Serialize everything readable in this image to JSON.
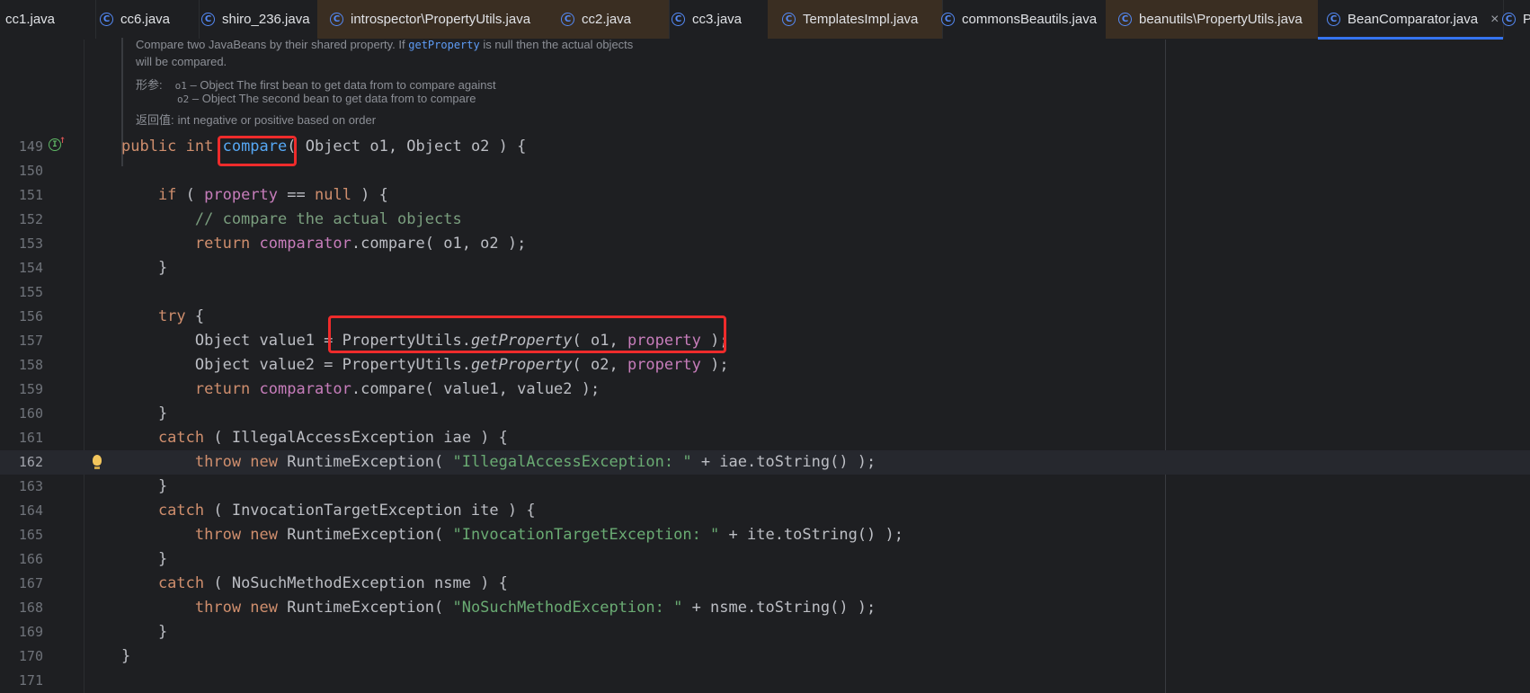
{
  "tabs": [
    {
      "label": "cc1.java",
      "modified": false,
      "active": false
    },
    {
      "label": "cc6.java",
      "modified": false,
      "active": false
    },
    {
      "label": "shiro_236.java",
      "modified": false,
      "active": false
    },
    {
      "label": "introspector\\PropertyUtils.java",
      "modified": true,
      "active": false
    },
    {
      "label": "cc2.java",
      "modified": true,
      "active": false
    },
    {
      "label": "cc3.java",
      "modified": false,
      "active": false
    },
    {
      "label": "TemplatesImpl.java",
      "modified": true,
      "active": false
    },
    {
      "label": "commonsBeautils.java",
      "modified": false,
      "active": false
    },
    {
      "label": "beanutils\\PropertyUtils.java",
      "modified": true,
      "active": false
    },
    {
      "label": "BeanComparator.java",
      "modified": false,
      "active": true
    },
    {
      "label": "P",
      "modified": false,
      "active": false
    }
  ],
  "doc": {
    "line1_pre": "Compare two JavaBeans by their shared property. If ",
    "line1_code": "getProperty",
    "line1_post": " is null then the actual objects",
    "line2": "will be compared.",
    "params_label": "形参:",
    "param1_name": "o1",
    "param1_desc": " – Object The first bean to get data from to compare against",
    "param2_name": "o2",
    "param2_desc": " – Object The second bean to get data from to compare",
    "returns_label": "返回值:",
    "returns_desc": "int negative or positive based on order"
  },
  "lines": [
    {
      "num": "149",
      "code": [
        {
          "t": "public int ",
          "c": "kw"
        },
        {
          "t": "compare",
          "c": "fn"
        },
        {
          "t": "( Object o1, Object o2 ) {",
          "c": ""
        }
      ]
    },
    {
      "num": "150",
      "code": []
    },
    {
      "num": "151",
      "code": [
        {
          "t": "    if",
          "c": "kw"
        },
        {
          "t": " ( ",
          "c": ""
        },
        {
          "t": "property",
          "c": "fld"
        },
        {
          "t": " == ",
          "c": ""
        },
        {
          "t": "null",
          "c": "kw"
        },
        {
          "t": " ) {",
          "c": ""
        }
      ]
    },
    {
      "num": "152",
      "code": [
        {
          "t": "        // compare the actual objects",
          "c": "cmt"
        }
      ]
    },
    {
      "num": "153",
      "code": [
        {
          "t": "        return ",
          "c": "kw"
        },
        {
          "t": "comparator",
          "c": "fld"
        },
        {
          "t": ".compare( o1, o2 );",
          "c": ""
        }
      ]
    },
    {
      "num": "154",
      "code": [
        {
          "t": "    }",
          "c": ""
        }
      ]
    },
    {
      "num": "155",
      "code": []
    },
    {
      "num": "156",
      "code": [
        {
          "t": "    try",
          "c": "kw"
        },
        {
          "t": " {",
          "c": ""
        }
      ]
    },
    {
      "num": "157",
      "code": [
        {
          "t": "        Object value1 = PropertyUtils.",
          "c": ""
        },
        {
          "t": "getProperty",
          "c": "it"
        },
        {
          "t": "( o1, ",
          "c": ""
        },
        {
          "t": "property",
          "c": "fld"
        },
        {
          "t": " );",
          "c": ""
        }
      ]
    },
    {
      "num": "158",
      "code": [
        {
          "t": "        Object value2 = PropertyUtils.",
          "c": ""
        },
        {
          "t": "getProperty",
          "c": "it"
        },
        {
          "t": "( o2, ",
          "c": ""
        },
        {
          "t": "property",
          "c": "fld"
        },
        {
          "t": " );",
          "c": ""
        }
      ]
    },
    {
      "num": "159",
      "code": [
        {
          "t": "        return ",
          "c": "kw"
        },
        {
          "t": "comparator",
          "c": "fld"
        },
        {
          "t": ".compare( value1, value2 );",
          "c": ""
        }
      ]
    },
    {
      "num": "160",
      "code": [
        {
          "t": "    }",
          "c": ""
        }
      ]
    },
    {
      "num": "161",
      "code": [
        {
          "t": "    catch",
          "c": "kw"
        },
        {
          "t": " ( IllegalAccessException iae ) {",
          "c": ""
        }
      ]
    },
    {
      "num": "162",
      "code": [
        {
          "t": "        throw new ",
          "c": "kw"
        },
        {
          "t": "RuntimeException( ",
          "c": ""
        },
        {
          "t": "\"IllegalAccessException: \"",
          "c": "str"
        },
        {
          "t": " + iae.toString() );",
          "c": ""
        }
      ]
    },
    {
      "num": "163",
      "code": [
        {
          "t": "    }",
          "c": ""
        }
      ]
    },
    {
      "num": "164",
      "code": [
        {
          "t": "    catch",
          "c": "kw"
        },
        {
          "t": " ( InvocationTargetException ite ) {",
          "c": ""
        }
      ]
    },
    {
      "num": "165",
      "code": [
        {
          "t": "        throw new ",
          "c": "kw"
        },
        {
          "t": "RuntimeException( ",
          "c": ""
        },
        {
          "t": "\"InvocationTargetException: \"",
          "c": "str"
        },
        {
          "t": " + ite.toString() );",
          "c": ""
        }
      ]
    },
    {
      "num": "166",
      "code": [
        {
          "t": "    }",
          "c": ""
        }
      ]
    },
    {
      "num": "167",
      "code": [
        {
          "t": "    catch",
          "c": "kw"
        },
        {
          "t": " ( NoSuchMethodException nsme ) {",
          "c": ""
        }
      ]
    },
    {
      "num": "168",
      "code": [
        {
          "t": "        throw new ",
          "c": "kw"
        },
        {
          "t": "RuntimeException( ",
          "c": ""
        },
        {
          "t": "\"NoSuchMethodException: \"",
          "c": "str"
        },
        {
          "t": " + nsme.toString() );",
          "c": ""
        }
      ]
    },
    {
      "num": "169",
      "code": [
        {
          "t": "    }",
          "c": ""
        }
      ]
    },
    {
      "num": "170",
      "code": [
        {
          "t": "}",
          "c": ""
        }
      ]
    },
    {
      "num": "171",
      "code": []
    }
  ],
  "current_line": "162"
}
